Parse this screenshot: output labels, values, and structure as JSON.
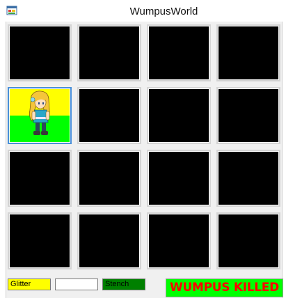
{
  "window": {
    "title": "WumpusWorld",
    "icon": "windows-form-icon"
  },
  "board": {
    "rows": 4,
    "cols": 4,
    "agent": {
      "row": 2,
      "col": 1,
      "icon": "agent-girl-sprite"
    },
    "cell_color": "#000000",
    "agent_cell_colors": {
      "top": "#ffff00",
      "bottom": "#00ff00"
    }
  },
  "percepts": {
    "glitter": {
      "label": "Glitter",
      "color": "#ffff00"
    },
    "breeze": {
      "label": "",
      "color": "#ffffff"
    },
    "stench": {
      "label": "Stench",
      "color": "#008000"
    }
  },
  "status": {
    "text": "WUMPUS KILLED",
    "text_color": "#ff0000",
    "background": "#00ff00"
  }
}
